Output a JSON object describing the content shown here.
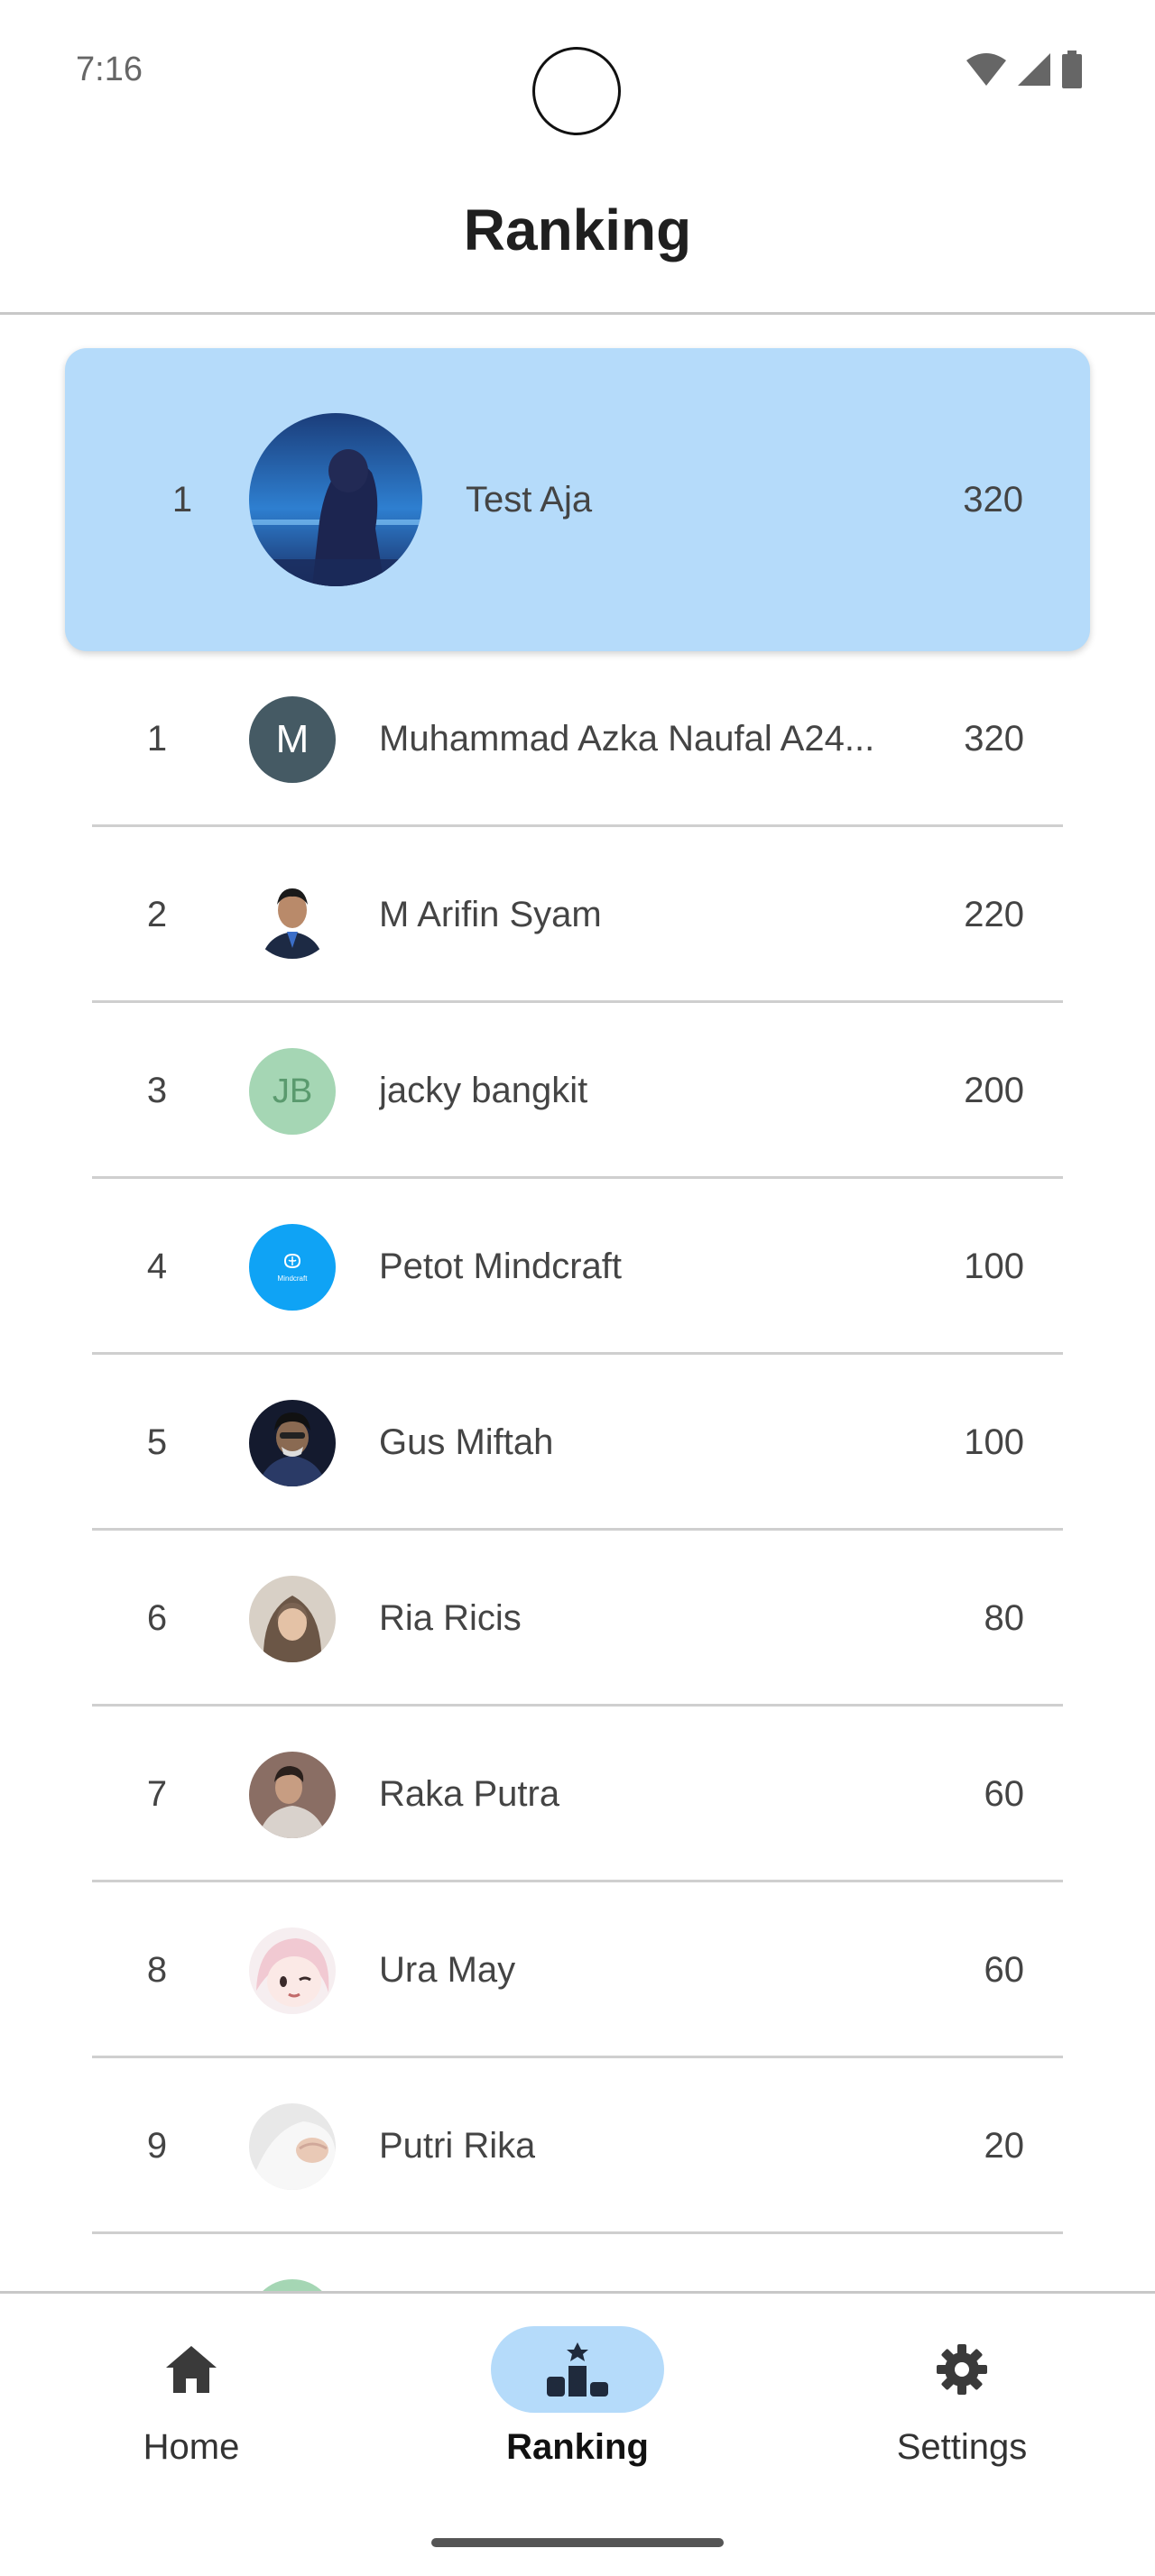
{
  "status_bar": {
    "time": "7:16",
    "icons": [
      "wifi-icon",
      "signal-icon",
      "battery-icon"
    ]
  },
  "header": {
    "title": "Ranking"
  },
  "current_user": {
    "rank": "1",
    "name": "Test Aja",
    "score": "320",
    "highlight_color": "#b5dbfa"
  },
  "ranking": [
    {
      "rank": "1",
      "name": "Muhammad Azka Naufal A24...",
      "score": "320",
      "avatar": {
        "type": "letter",
        "text": "M",
        "bg": "#455a64",
        "fg": "#ffffff"
      }
    },
    {
      "rank": "2",
      "name": "M Arifin Syam",
      "score": "220",
      "avatar": {
        "type": "photo",
        "text": ""
      }
    },
    {
      "rank": "3",
      "name": "jacky bangkit",
      "score": "200",
      "avatar": {
        "type": "letter",
        "text": "JB",
        "bg": "#a5d6b4",
        "fg": "#5a9a6e"
      }
    },
    {
      "rank": "4",
      "name": "Petot Mindcraft",
      "score": "100",
      "avatar": {
        "type": "logo",
        "text": "Mindcraft"
      }
    },
    {
      "rank": "5",
      "name": "Gus Miftah",
      "score": "100",
      "avatar": {
        "type": "photo",
        "text": ""
      }
    },
    {
      "rank": "6",
      "name": "Ria Ricis",
      "score": "80",
      "avatar": {
        "type": "photo",
        "text": ""
      }
    },
    {
      "rank": "7",
      "name": "Raka Putra",
      "score": "60",
      "avatar": {
        "type": "photo",
        "text": ""
      }
    },
    {
      "rank": "8",
      "name": "Ura May",
      "score": "60",
      "avatar": {
        "type": "photo",
        "text": ""
      }
    },
    {
      "rank": "9",
      "name": "Putri Rika",
      "score": "20",
      "avatar": {
        "type": "photo",
        "text": ""
      }
    }
  ],
  "bottom_nav": {
    "items": [
      {
        "label": "Home",
        "icon": "home-icon",
        "active": false
      },
      {
        "label": "Ranking",
        "icon": "podium-icon",
        "active": true
      },
      {
        "label": "Settings",
        "icon": "gear-icon",
        "active": false
      }
    ]
  },
  "colors": {
    "accent": "#b5dbfa",
    "divider": "#cfcfcf"
  }
}
